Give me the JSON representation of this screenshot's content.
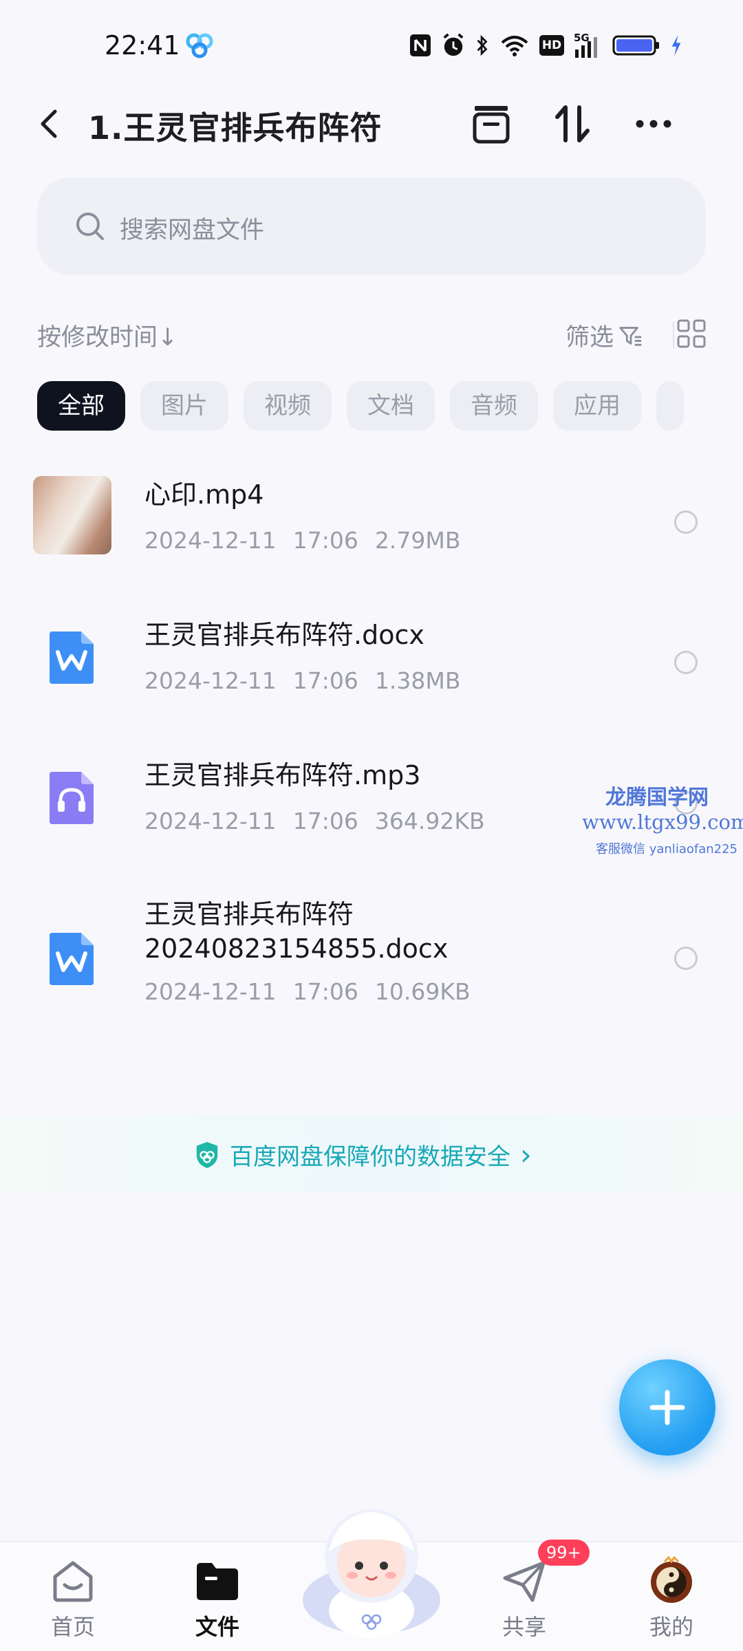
{
  "status_bar": {
    "time": "22:41",
    "icons": [
      "baidu-netdisk-icon",
      "nfc-icon",
      "alarm-icon",
      "bluetooth-icon",
      "wifi-icon",
      "hd-icon",
      "signal-5g-icon",
      "battery-icon",
      "charging-icon"
    ],
    "hd_label": "HD",
    "network_label": "5G"
  },
  "appbar": {
    "title": "1.王灵官排兵布阵符",
    "actions": [
      "archive-icon",
      "transfer-icon",
      "more-icon"
    ]
  },
  "search": {
    "placeholder": "搜索网盘文件"
  },
  "sortbar": {
    "sort_label": "按修改时间",
    "sort_arrow": "↓",
    "filter_label": "筛选"
  },
  "tabs": [
    "全部",
    "图片",
    "视频",
    "文档",
    "音频",
    "应用"
  ],
  "files": [
    {
      "name": "心印.mp4",
      "date": "2024-12-11",
      "time": "17:06",
      "size": "2.79MB",
      "type": "video"
    },
    {
      "name": "王灵官排兵布阵符.docx",
      "date": "2024-12-11",
      "time": "17:06",
      "size": "1.38MB",
      "type": "word"
    },
    {
      "name": "王灵官排兵布阵符.mp3",
      "date": "2024-12-11",
      "time": "17:06",
      "size": "364.92KB",
      "type": "audio"
    },
    {
      "name_line1": "王灵官排兵布阵符",
      "name_line2": "20240823154855.docx",
      "date": "2024-12-11",
      "time": "17:06",
      "size": "10.69KB",
      "type": "word"
    }
  ],
  "watermark": {
    "line1": "龙腾国学网",
    "line2": "www.ltgx99.com",
    "line3": "客服微信 yanliaofan225"
  },
  "safety_banner": {
    "text": "百度网盘保障你的数据安全",
    "arrow": "›"
  },
  "bottom_nav": {
    "items": [
      {
        "label": "首页",
        "icon": "home-icon"
      },
      {
        "label": "文件",
        "icon": "folder-icon",
        "active": true
      },
      {
        "label": "共享",
        "icon": "share-plane-icon"
      },
      {
        "label": "我的",
        "icon": "profile-avatar-icon"
      }
    ],
    "share_badge": "99+"
  },
  "colors": {
    "accent": "#209cf0",
    "safety_text": "#18a8b8",
    "badge": "#ff3f5a",
    "active_tab": "#0f1320"
  }
}
